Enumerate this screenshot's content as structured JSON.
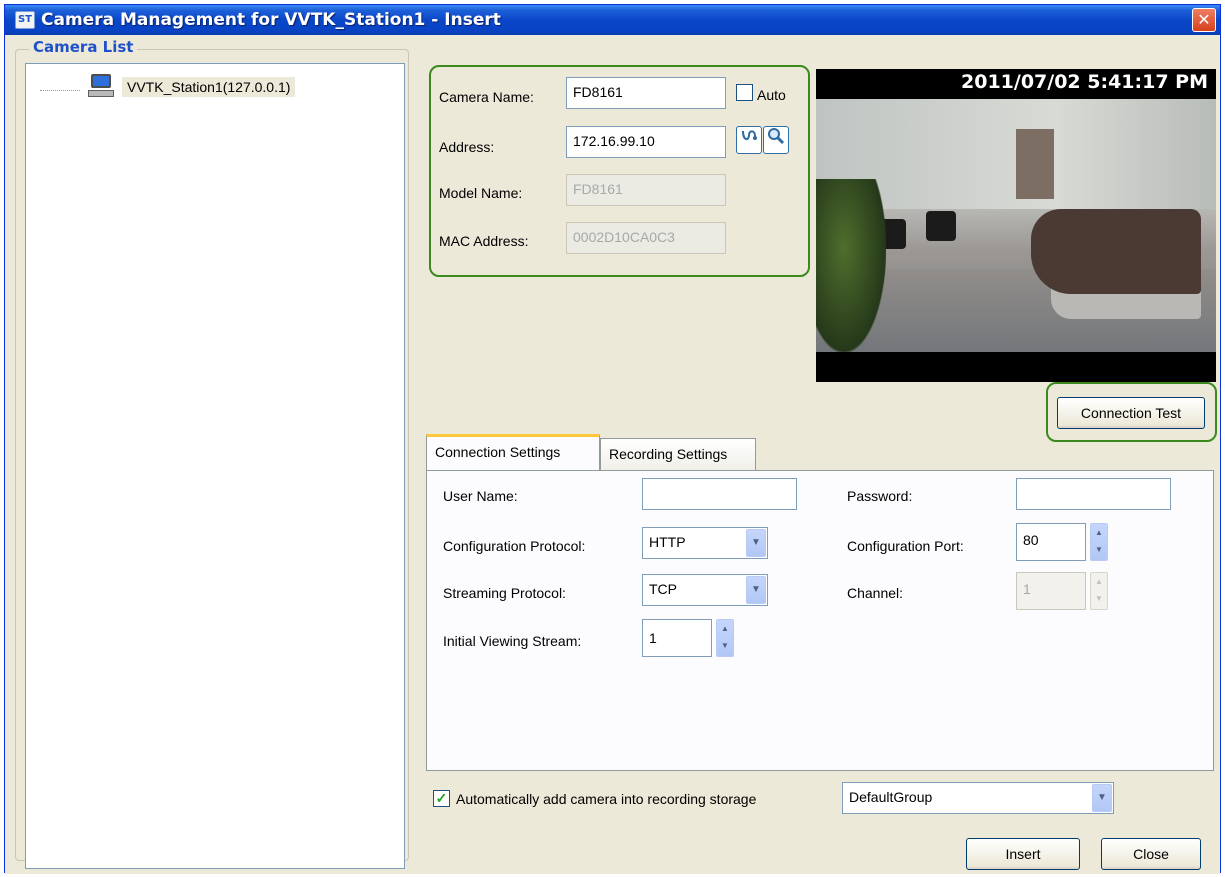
{
  "window": {
    "title": "Camera Management for VVTK_Station1 - Insert",
    "app_icon_text": "ST",
    "close_glyph": "✕"
  },
  "camera_list": {
    "group_label": "Camera List",
    "items": [
      {
        "label": "VVTK_Station1(127.0.0.1)",
        "icon": "computer-icon"
      }
    ]
  },
  "camera_info": {
    "camera_name_label": "Camera Name:",
    "camera_name_value": "FD8161",
    "auto_label": "Auto",
    "auto_checked": false,
    "address_label": "Address:",
    "address_value": "172.16.99.10",
    "model_name_label": "Model Name:",
    "model_name_value": "FD8161",
    "mac_address_label": "MAC Address:",
    "mac_address_value": "0002D10CA0C3",
    "network_search_icon": "network-search-icon",
    "search_icon": "magnifier-icon"
  },
  "preview": {
    "timestamp": "2011/07/02 5:41:17 PM",
    "connection_test_label": "Connection Test"
  },
  "tabs": [
    {
      "label": "Connection Settings",
      "active": true
    },
    {
      "label": "Recording Settings",
      "active": false
    }
  ],
  "connection_settings": {
    "user_name_label": "User Name:",
    "user_name_value": "",
    "password_label": "Password:",
    "password_value": "",
    "config_protocol_label": "Configuration Protocol:",
    "config_protocol_value": "HTTP",
    "config_port_label": "Configuration Port:",
    "config_port_value": "80",
    "streaming_protocol_label": "Streaming Protocol:",
    "streaming_protocol_value": "TCP",
    "channel_label": "Channel:",
    "channel_value": "1",
    "initial_stream_label": "Initial Viewing Stream:",
    "initial_stream_value": "1"
  },
  "footer": {
    "auto_add_label": "Automatically add camera into recording storage",
    "auto_add_checked": true,
    "storage_group_value": "DefaultGroup",
    "insert_label": "Insert",
    "close_label": "Close"
  },
  "colors": {
    "highlight_green": "#3a8a1e",
    "title_blue": "#0a47c8",
    "group_label_blue": "#1f52c9"
  }
}
